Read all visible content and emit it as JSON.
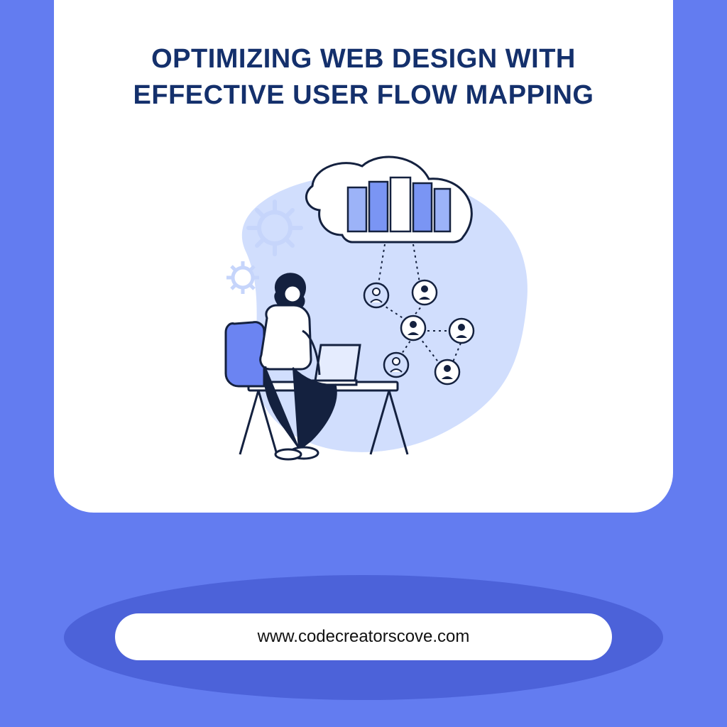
{
  "title_line1": "OPTIMIZING WEB DESIGN WITH",
  "title_line2": "EFFECTIVE USER FLOW MAPPING",
  "footer_url": "www.codecreatorscove.com",
  "colors": {
    "bg": "#637CF0",
    "accent": "#14306C",
    "shadow": "#4C62D9",
    "illo_blob": "#D1DEFD",
    "illo_stroke": "#14213F"
  }
}
